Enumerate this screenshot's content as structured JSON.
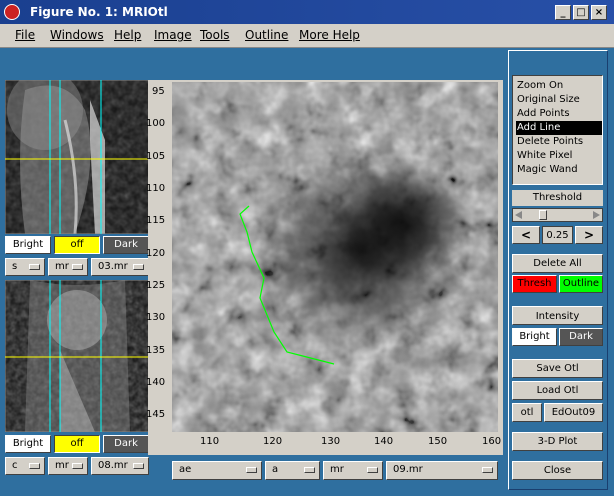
{
  "window": {
    "title": "Figure No. 1: MRIOtl"
  },
  "menus": [
    "File",
    "Windows",
    "Help",
    "Image",
    "Tools",
    "Outline",
    "More Help"
  ],
  "window_buttons": {
    "minimize": "_",
    "maximize": "□",
    "close": "×"
  },
  "left": {
    "top_controls": {
      "bright": "Bright",
      "off": "off",
      "dark": "Dark"
    },
    "top_popups": [
      "s",
      "mr",
      "03.mr"
    ],
    "bottom_controls": {
      "bright": "Bright",
      "off": "off",
      "dark": "Dark"
    },
    "bottom_popups": [
      "c",
      "mr",
      "08.mr"
    ]
  },
  "main_axes": {
    "y_ticks": [
      "95",
      "100",
      "105",
      "110",
      "115",
      "120",
      "125",
      "130",
      "135",
      "140",
      "145"
    ],
    "x_ticks": [
      "110",
      "120",
      "130",
      "140",
      "150",
      "160"
    ]
  },
  "bottom_popups": [
    "ae",
    "a",
    "mr",
    "09.mr"
  ],
  "tools": {
    "items": [
      "Zoom On",
      "Original Size",
      "Add Points",
      "Add Line",
      "Delete Points",
      "White Pixel",
      "Magic Wand"
    ],
    "selected": "Add Line"
  },
  "threshold": {
    "label": "Threshold",
    "prev": "<",
    "value": "0.25",
    "next": ">"
  },
  "delete_all": {
    "label": "Delete All",
    "thresh": "Thresh",
    "outline": "Outline"
  },
  "intensity": {
    "label": "Intensity",
    "bright": "Bright",
    "dark": "Dark"
  },
  "actions": {
    "save": "Save Otl",
    "load": "Load Otl",
    "otl": "otl",
    "edout": "EdOut09",
    "plot3d": "3-D Plot",
    "close": "Close"
  },
  "colors": {
    "accent_yellow": "#ffff00",
    "thresh_red": "#ff0000",
    "outline_green": "#00ff00",
    "panel_blue": "#2f6f9f",
    "title_blue": "#1a3f8f"
  }
}
